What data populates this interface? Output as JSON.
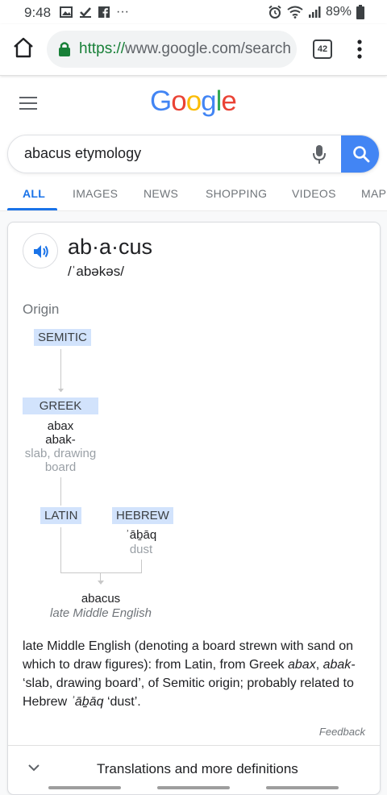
{
  "status_bar": {
    "time": "9:48",
    "more": "···",
    "battery": "89%"
  },
  "browser": {
    "url_scheme": "https://",
    "url_rest": "www.google.com/search?q=abacus+etymology",
    "tab_count": "42"
  },
  "search": {
    "query": "abacus etymology"
  },
  "tabs": [
    "ALL",
    "IMAGES",
    "NEWS",
    "SHOPPING",
    "VIDEOS",
    "MAPS"
  ],
  "dictionary": {
    "word": "ab·a·cus",
    "pronunciation": "/ˈabəkəs/",
    "origin_label": "Origin",
    "etymology": {
      "semitic": "SEMITIC",
      "greek": "GREEK",
      "greek_word_1": "abax",
      "greek_word_2": "abak-",
      "greek_gloss": "slab, drawing board",
      "latin": "LATIN",
      "hebrew": "HEBREW",
      "hebrew_word": "ʾāḇāq",
      "hebrew_gloss": "dust",
      "result_word": "abacus",
      "result_lang": "late Middle English"
    },
    "definition": {
      "part1": "late Middle English (denoting a board strewn with sand on which to draw figures): from Latin, from Greek ",
      "abax": "abax",
      "comma": ", ",
      "abak": "abak-",
      "part2": " ‘slab, drawing board’, of Semitic origin; probably related to Hebrew ",
      "abaq": "ʾāḇāq",
      "part3": " ‘dust’."
    },
    "feedback": "Feedback",
    "more_label": "Translations and more definitions"
  },
  "colors": {
    "accent": "#1a73e8",
    "node_bg": "#d2e3fc",
    "search_btn": "#4285f4"
  }
}
